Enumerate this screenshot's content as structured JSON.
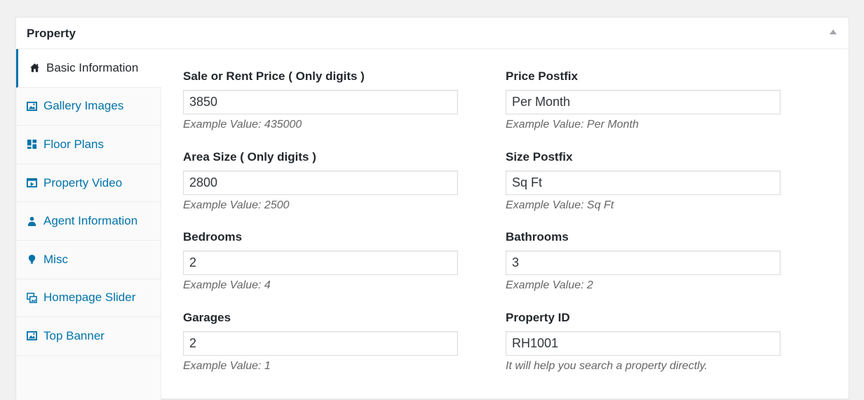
{
  "metabox": {
    "title": "Property"
  },
  "tabs": [
    {
      "label": "Basic Information",
      "icon": "home-icon",
      "active": true
    },
    {
      "label": "Gallery Images",
      "icon": "gallery-icon",
      "active": false
    },
    {
      "label": "Floor Plans",
      "icon": "floor-plan-icon",
      "active": false
    },
    {
      "label": "Property Video",
      "icon": "video-icon",
      "active": false
    },
    {
      "label": "Agent Information",
      "icon": "agent-icon",
      "active": false
    },
    {
      "label": "Misc",
      "icon": "lightbulb-icon",
      "active": false
    },
    {
      "label": "Homepage Slider",
      "icon": "slider-icon",
      "active": false
    },
    {
      "label": "Top Banner",
      "icon": "banner-image-icon",
      "active": false
    }
  ],
  "fields": {
    "price": {
      "label": "Sale or Rent Price ( Only digits )",
      "value": "3850",
      "desc": "Example Value: 435000"
    },
    "price_postfix": {
      "label": "Price Postfix",
      "value": "Per Month",
      "desc": "Example Value: Per Month"
    },
    "area": {
      "label": "Area Size ( Only digits )",
      "value": "2800",
      "desc": "Example Value: 2500"
    },
    "size_postfix": {
      "label": "Size Postfix",
      "value": "Sq Ft",
      "desc": "Example Value: Sq Ft"
    },
    "bedrooms": {
      "label": "Bedrooms",
      "value": "2",
      "desc": "Example Value: 4"
    },
    "bathrooms": {
      "label": "Bathrooms",
      "value": "3",
      "desc": "Example Value: 2"
    },
    "garages": {
      "label": "Garages",
      "value": "2",
      "desc": "Example Value: 1"
    },
    "property_id": {
      "label": "Property ID",
      "value": "RH1001",
      "desc": "It will help you search a property directly."
    }
  },
  "colors": {
    "link": "#0073aa",
    "text": "#23282d",
    "muted": "#666666",
    "border": "#dddddd"
  }
}
